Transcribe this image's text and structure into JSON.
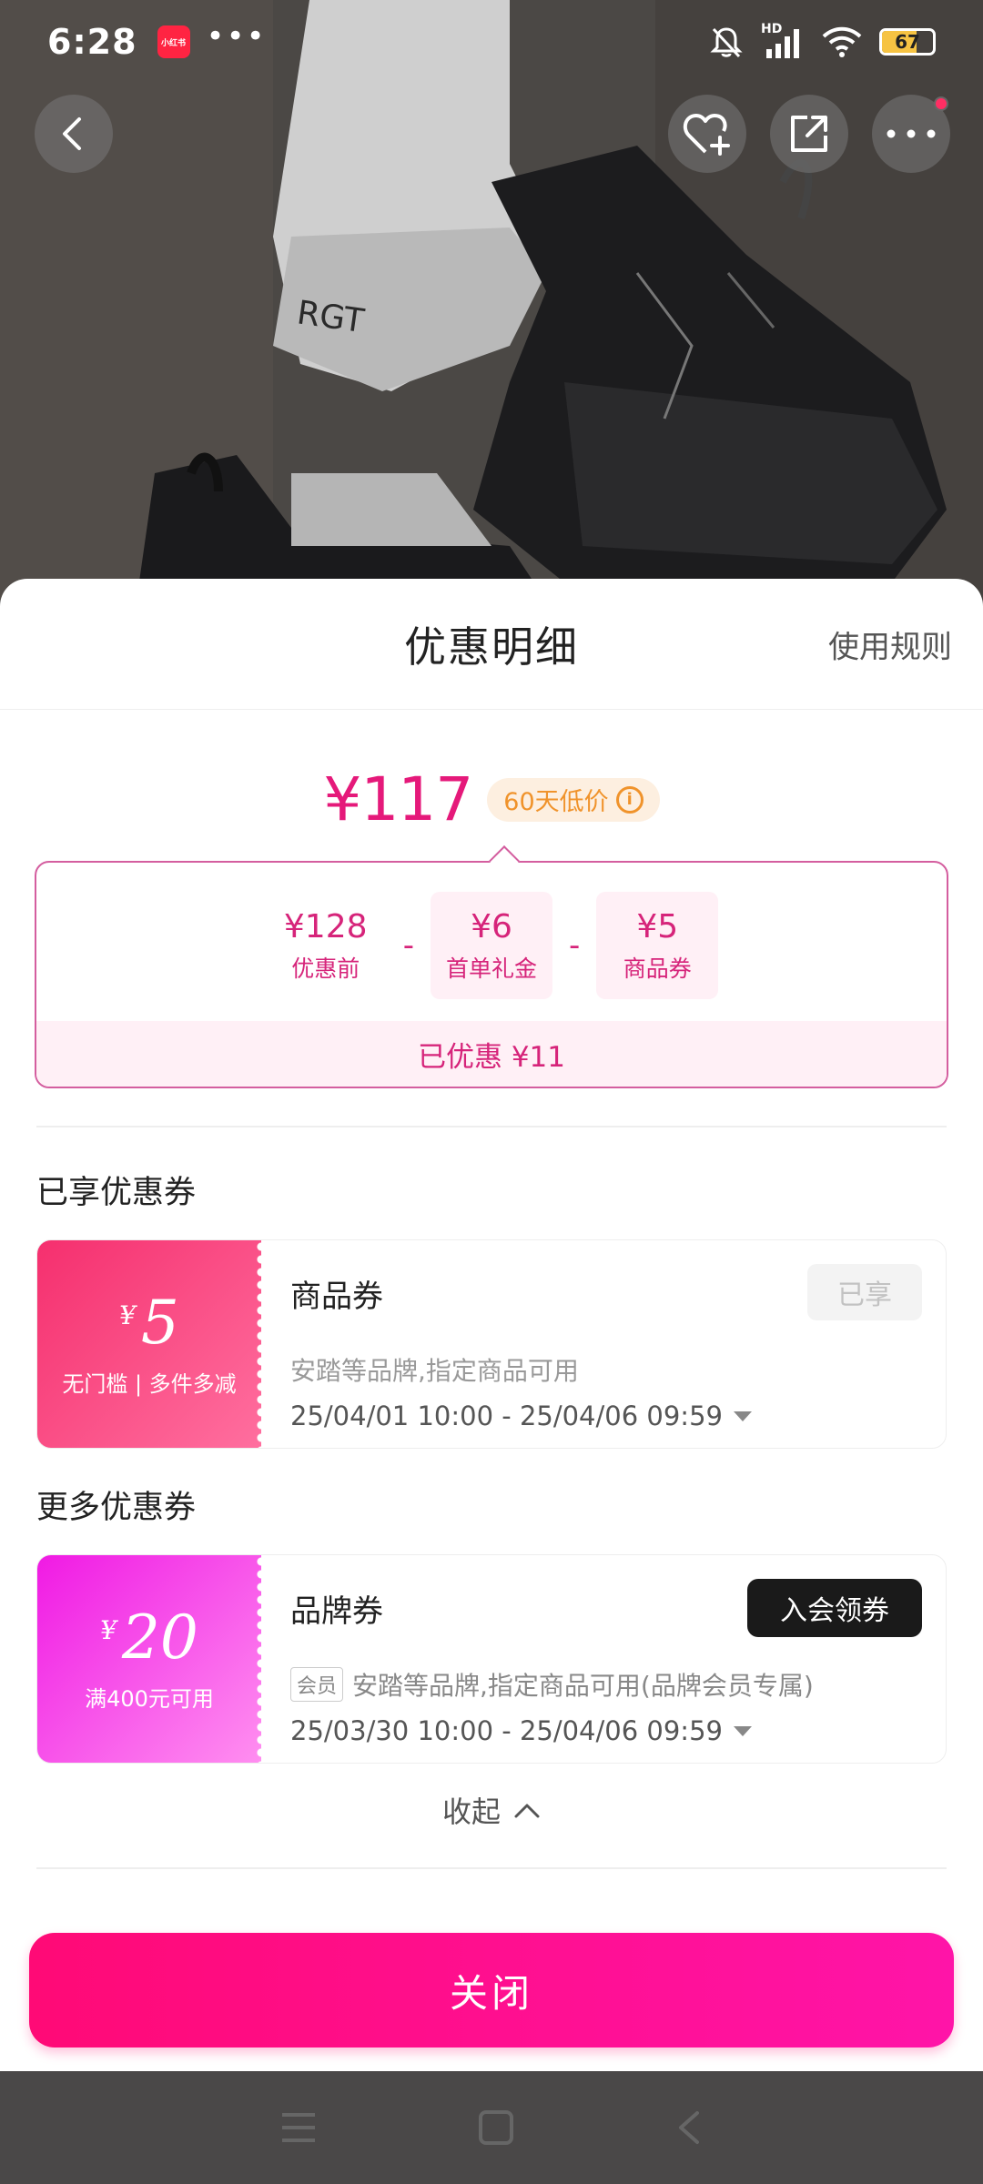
{
  "status_bar": {
    "time": "6:28",
    "app_badge": "小红书",
    "more_dots": "•••",
    "battery_level": 67,
    "battery_text": "67",
    "network_label": "HD"
  },
  "colors": {
    "accent": "#e5197a",
    "close_button": "#ff0a76",
    "coupon_red": "#f52f6e",
    "coupon_purple": "#f01ae4",
    "low_price_badge": "#f0932b"
  },
  "sheet": {
    "title": "优惠明细",
    "rules_link": "使用规则",
    "final_price": "¥117",
    "low_price_badge": "60天低价",
    "breakdown": {
      "items": [
        {
          "value": "¥128",
          "label": "优惠前"
        },
        {
          "value": "¥6",
          "label": "首单礼金"
        },
        {
          "value": "¥5",
          "label": "商品券"
        }
      ],
      "operator": "-",
      "total": "已优惠 ¥11"
    },
    "enjoyed_section_title": "已享优惠券",
    "more_section_title": "更多优惠券",
    "coupons": [
      {
        "symbol": "¥",
        "amount": "5",
        "condition": "无门槛 | 多件多减",
        "name": "商品券",
        "button": "已享",
        "description": "安踏等品牌,指定商品可用",
        "date_range": "25/04/01 10:00 - 25/04/06 09:59"
      },
      {
        "symbol": "¥",
        "amount": "20",
        "condition": "满400元可用",
        "name": "品牌券",
        "button": "入会领券",
        "tag": "会员",
        "description": "安踏等品牌,指定商品可用(品牌会员专属)",
        "date_range": "25/03/30 10:00 - 25/04/06 09:59"
      }
    ],
    "collapse_label": "收起",
    "close_button": "关闭"
  },
  "icons": {
    "back": "chevron-left-icon",
    "favorite": "heart-plus-icon",
    "share": "share-icon",
    "more": "more-dots-icon",
    "info": "info-icon",
    "collapse": "chevron-up-icon",
    "date_expand": "triangle-down-icon",
    "nav_menu": "menu-icon",
    "nav_home": "home-square-icon",
    "nav_back": "nav-back-icon"
  }
}
